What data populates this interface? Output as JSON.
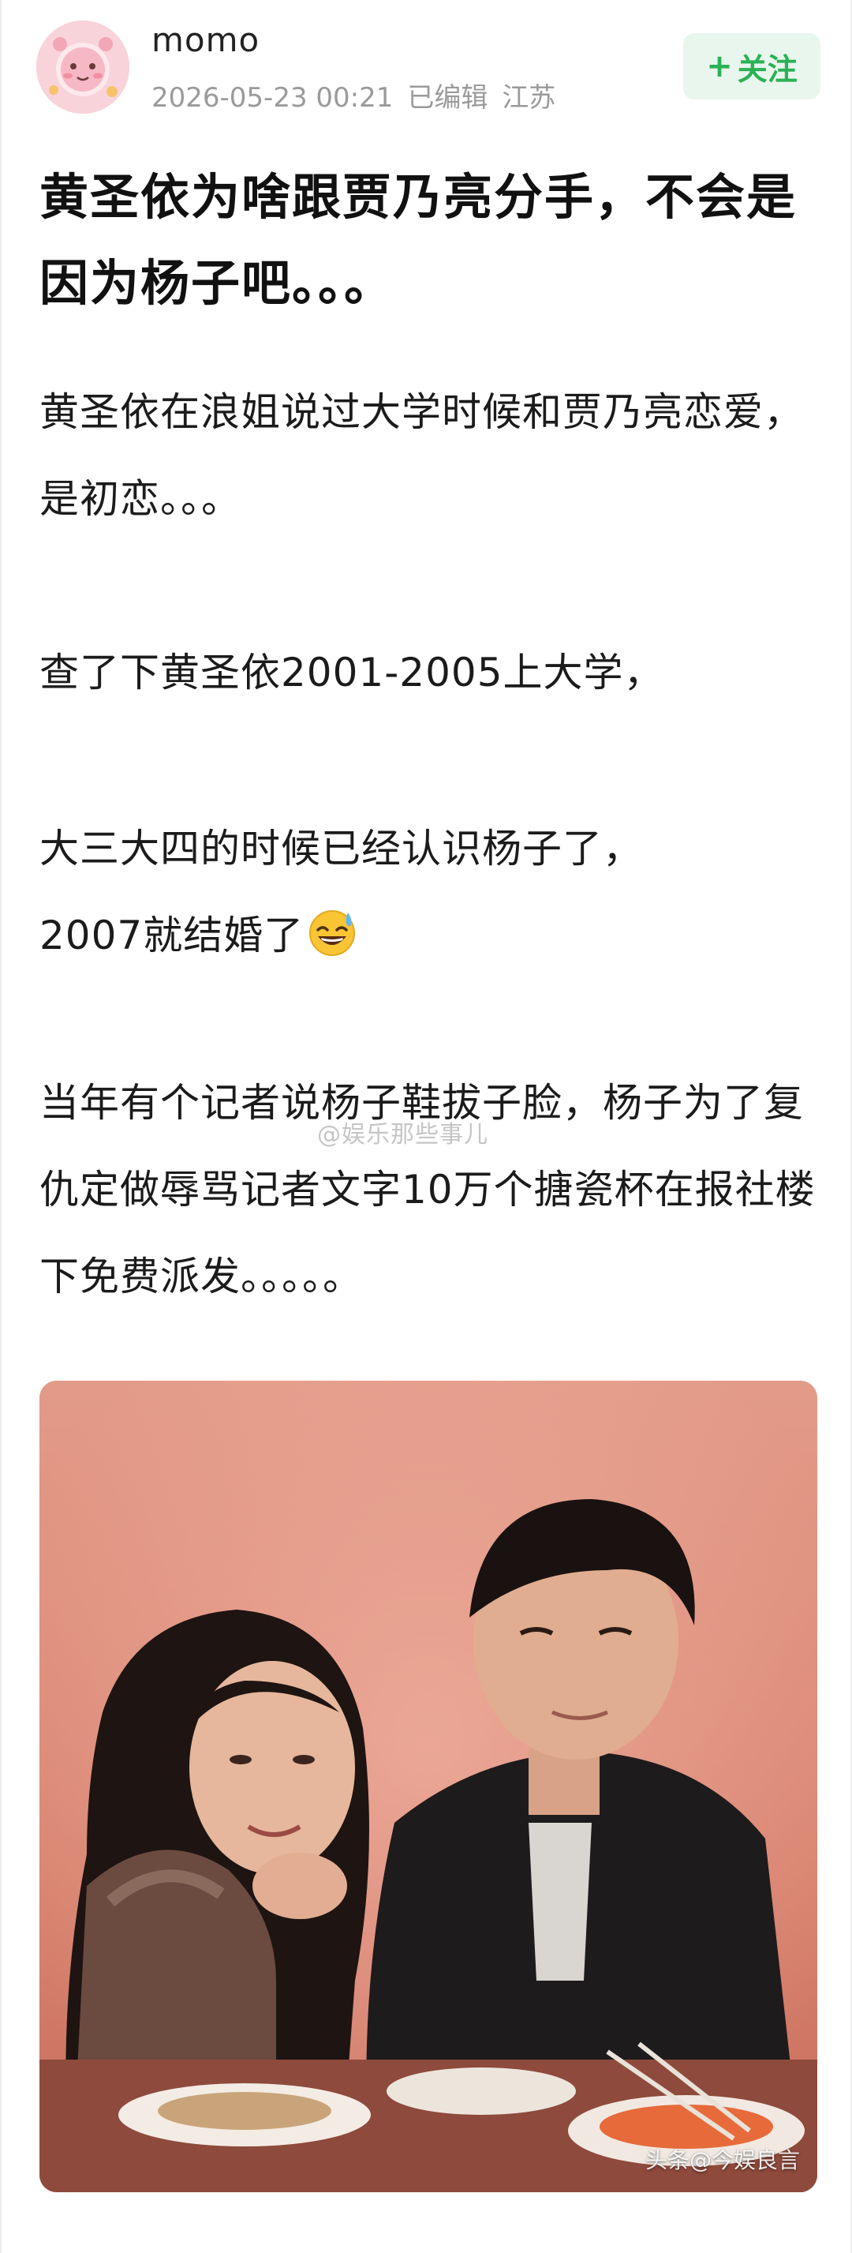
{
  "header": {
    "username": "momo",
    "date": "2026-05-23 00:21",
    "edited": "已编辑",
    "location": "江苏",
    "follow_plus": "+",
    "follow_label": "关注"
  },
  "post": {
    "title": "黄圣依为啥跟贾乃亮分手，不会是因为杨子吧。。。",
    "paragraphs": [
      "黄圣依在浪姐说过大学时候和贾乃亮恋爱，是初恋。。。",
      "查了下黄圣依2001-2005上大学，",
      "大三大四的时候已经认识杨子了，\n2007就结婚了",
      "当年有个记者说杨子鞋拔子脸，杨子为了复仇定做辱骂记者文字10万个搪瓷杯在报社楼下免费派发。。。。。"
    ],
    "emoji": "sweat-smile-emoji",
    "watermark": "@娱乐那些事儿",
    "image_credit": "头条@今娱良言"
  },
  "colors": {
    "accent_green": "#2bb155",
    "follow_bg": "#e8f6ee",
    "meta_gray": "#9a9a9a",
    "photo_bg": "#d98678"
  }
}
